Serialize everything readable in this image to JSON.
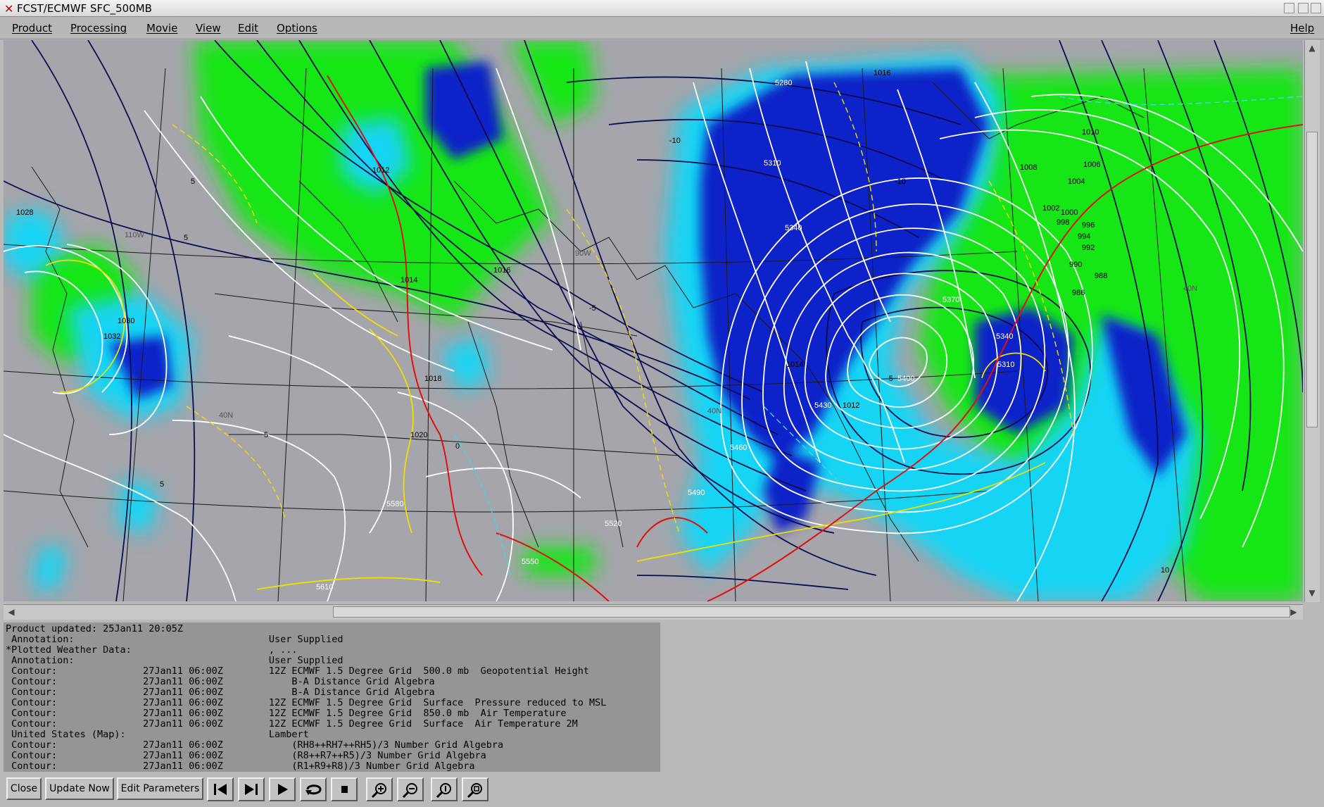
{
  "window": {
    "title": "FCST/ECMWF SFC_500MB"
  },
  "menu": {
    "product": "Product",
    "processing": "Processing",
    "movie": "Movie",
    "view": "View",
    "edit": "Edit",
    "options": "Options",
    "help": "Help"
  },
  "map": {
    "geopotential_labels": [
      "5280",
      "5310",
      "5340",
      "5370",
      "5340",
      "5310",
      "5400",
      "5430",
      "5460",
      "5490",
      "5520",
      "5550",
      "5580",
      "5610"
    ],
    "pressure_labels": [
      "1012",
      "1014",
      "1016",
      "1016",
      "1018",
      "1020",
      "1030",
      "1032",
      "1028",
      "1014",
      "1012",
      "1010",
      "1008",
      "1006",
      "1004",
      "1002",
      "1000",
      "998",
      "996",
      "994",
      "992",
      "990",
      "988",
      "986"
    ],
    "temperature_labels": [
      "5",
      "5",
      "5",
      "5",
      "0",
      "-5",
      "-5",
      "-10",
      "-10",
      "10"
    ],
    "grid_labels": [
      "40N",
      "40N",
      "40N",
      "90W",
      "110W"
    ],
    "colors": {
      "background": "#a5a5ab",
      "rh_green": "#19e619",
      "rh_blue": "#0a23c8",
      "rh_cyan": "#14d4f4",
      "geopotential": "#0c0c4e",
      "pressure": "#ffffff",
      "temperature_yellow": "#f0e000",
      "temperature_red": "#e01010",
      "temperature_cyan": "#40d8e8"
    }
  },
  "info": {
    "lines": [
      "Product updated: 25Jan11 20:05Z",
      " Annotation:                                  User Supplied",
      "*Plotted Weather Data:                        , ...",
      " Annotation:                                  User Supplied",
      " Contour:               27Jan11 06:00Z        12Z ECMWF 1.5 Degree Grid  500.0 mb  Geopotential Height",
      " Contour:               27Jan11 06:00Z            B-A Distance Grid Algebra",
      " Contour:               27Jan11 06:00Z            B-A Distance Grid Algebra",
      " Contour:               27Jan11 06:00Z        12Z ECMWF 1.5 Degree Grid  Surface  Pressure reduced to MSL",
      " Contour:               27Jan11 06:00Z        12Z ECMWF 1.5 Degree Grid  850.0 mb  Air Temperature",
      " Contour:               27Jan11 06:00Z        12Z ECMWF 1.5 Degree Grid  Surface  Air Temperature 2M",
      " United States (Map):                         Lambert",
      " Contour:               27Jan11 06:00Z            (RH8++RH7++RH5)/3 Number Grid Algebra",
      " Contour:               27Jan11 06:00Z            (R8++R7++R5)/3 Number Grid Algebra",
      " Contour:               27Jan11 06:00Z            (R1+R9+R8)/3 Number Grid Algebra"
    ]
  },
  "toolbar": {
    "close": "Close",
    "update_now": "Update Now",
    "edit_parameters": "Edit Parameters",
    "icons": [
      "first-frame-icon",
      "step-forward-icon",
      "play-icon",
      "loop-icon",
      "stop-icon",
      "zoom-in-icon",
      "zoom-out-icon",
      "zoom-reset-icon",
      "zoom-fit-icon"
    ]
  }
}
